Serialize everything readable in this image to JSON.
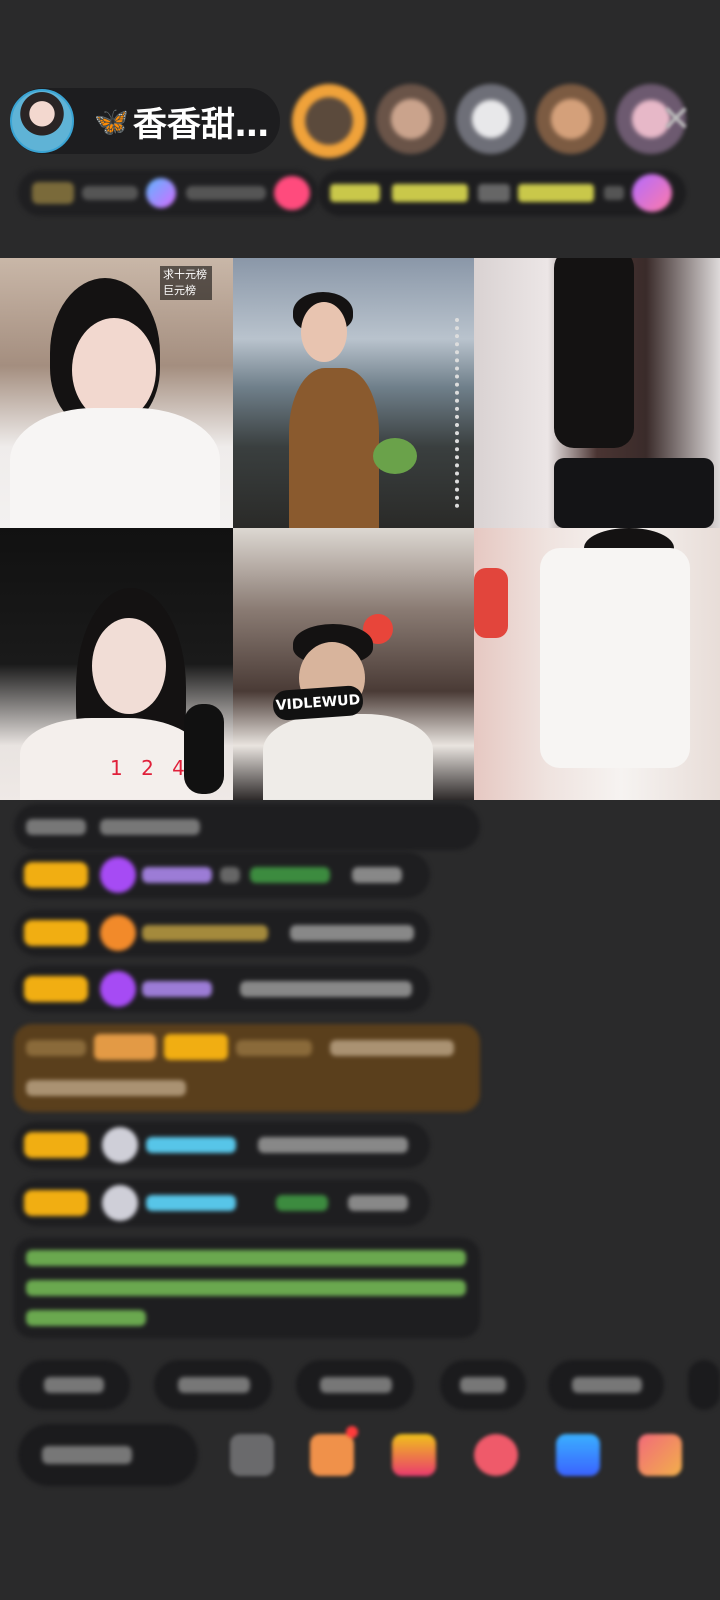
{
  "host": {
    "name": "香香甜…",
    "butterfly_icon": "🦋"
  },
  "grid": {
    "cell1_tag": "求十元榜 巨元榜",
    "cell4_counter": "1 2 4",
    "cell5_mic_label": "VIDLEWUD"
  },
  "close_icon": "✕",
  "colors": {
    "badge": "#f1ae12",
    "gold_message": "#5a3f1c",
    "purple_gem": "#a64bf4",
    "orange_gem": "#f28a2a",
    "cyan_name": "#57c5e8",
    "green_text": "#8bd56b"
  }
}
